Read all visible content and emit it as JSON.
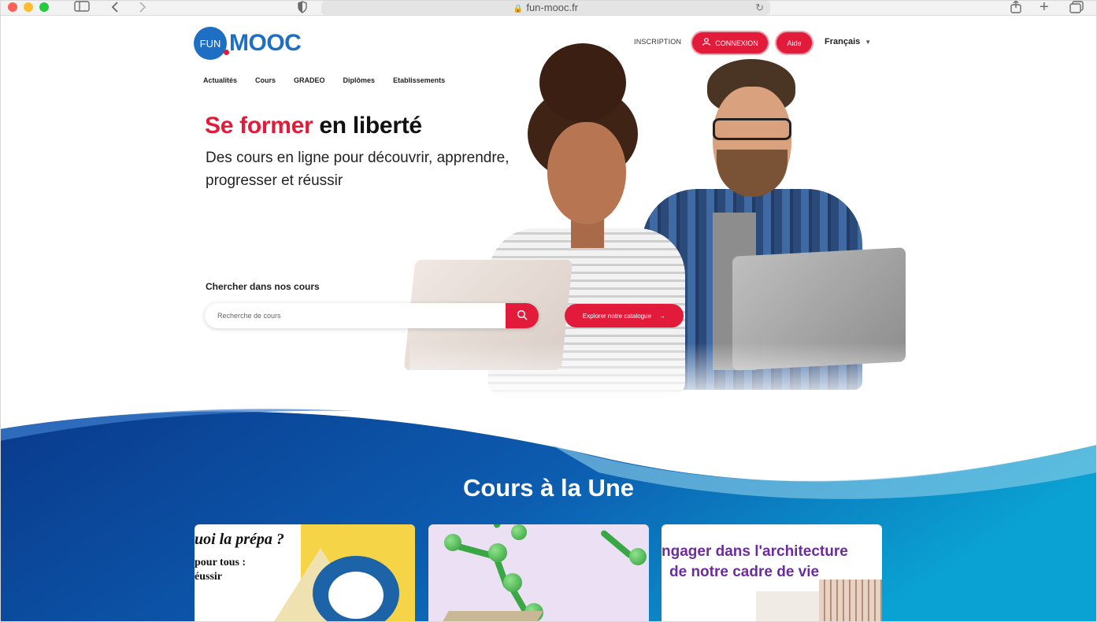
{
  "browser": {
    "url": "fun-mooc.fr",
    "icons": [
      "sidebar-icon",
      "back-icon",
      "forward-icon",
      "shield-icon",
      "lock-icon",
      "reload-icon",
      "share-icon",
      "new-tab-icon",
      "tabs-overview-icon"
    ]
  },
  "header": {
    "logo_badge": "FUN",
    "logo_text": "MOOC",
    "inscription_label": "INSCRIPTION",
    "connexion_label": "CONNEXION",
    "aide_label": "Aide",
    "language_label": "Français"
  },
  "nav": {
    "items": [
      {
        "label": "Actualités"
      },
      {
        "label": "Cours"
      },
      {
        "label": "GRADEO"
      },
      {
        "label": "Diplômes"
      },
      {
        "label": "Etablissements"
      }
    ]
  },
  "hero": {
    "title_highlight": "Se former",
    "title_rest": " en liberté",
    "subtitle": "Des cours en ligne pour découvrir, apprendre, progresser et réussir",
    "search_label": "Chercher dans nos cours",
    "search_placeholder": "Recherche de cours",
    "explore_label": "Explorer notre catalogue",
    "explore_arrow": "→"
  },
  "featured": {
    "title": "Cours à la Une",
    "cards": [
      {
        "lines": [
          "uoi la prépa ?",
          "pour tous :",
          "éussir"
        ]
      },
      {
        "lines": []
      },
      {
        "lines": [
          "ngager dans l'architecture",
          "de notre cadre de vie"
        ]
      }
    ]
  },
  "colors": {
    "brand_red": "#e31b3a",
    "brand_blue": "#1e6fc4",
    "wave_dark": "#0a3f91",
    "wave_light": "#0d9bd0",
    "card3_text": "#6b2c9e"
  }
}
